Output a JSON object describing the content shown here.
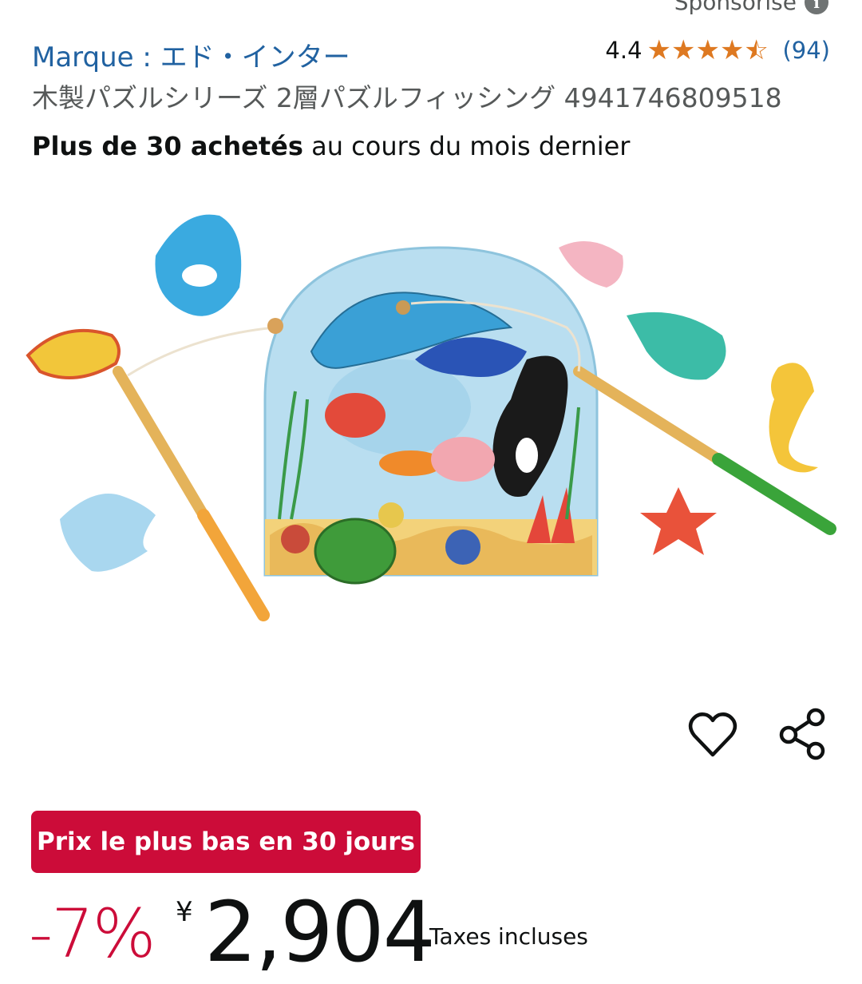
{
  "sponsored": {
    "label": "Sponsorisé"
  },
  "brand": {
    "label": "Marque : エド・インター"
  },
  "rating": {
    "value": "4.4",
    "stars": 4.4,
    "count": "(94)"
  },
  "product": {
    "title": "木製パズルシリーズ 2層パズルフィッシング 4941746809518",
    "bought_bold": "Plus de 30 achetés",
    "bought_rest": " au cours du mois dernier"
  },
  "deal": {
    "badge": "Prix le plus bas en 30 jours"
  },
  "price": {
    "discount": "-7%",
    "currency": "¥",
    "amount": "2,904",
    "tax_note": "Taxes incluses"
  },
  "colors": {
    "link": "#2162a1",
    "star": "#de7921",
    "deal_red": "#cc0c39"
  },
  "icons": [
    "info-icon",
    "star-icon",
    "heart-icon",
    "share-icon"
  ]
}
